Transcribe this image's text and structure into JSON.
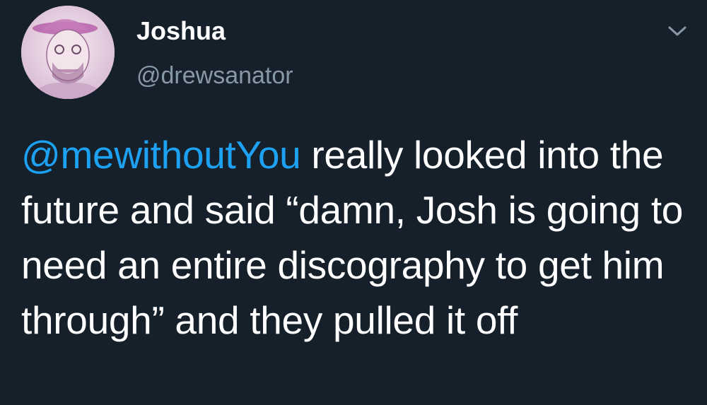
{
  "tweet": {
    "author": {
      "display_name": "Joshua",
      "handle": "@drewsanator",
      "avatar_icon": "profile-avatar"
    },
    "menu_icon": "chevron-down-icon",
    "body": {
      "mention": "@mewithoutYou",
      "text": " really looked into the future and said “damn, Josh is going to need an entire discography to get him through” and they pulled it off"
    }
  },
  "colors": {
    "background": "#15202b",
    "text": "#ffffff",
    "secondary_text": "#8899a6",
    "mention": "#1da1f2"
  }
}
